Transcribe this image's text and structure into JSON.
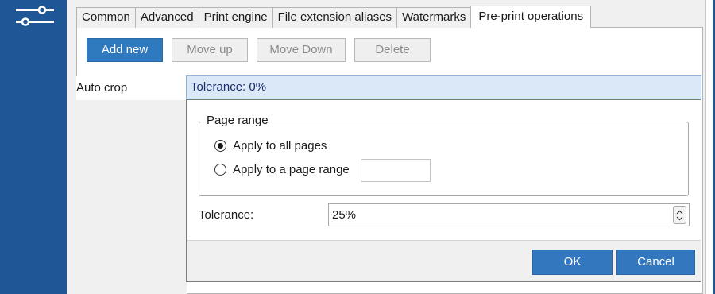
{
  "sidebar": {
    "icon": "settings-sliders-icon",
    "color": "#1f5796"
  },
  "tabs": [
    {
      "label": "Common"
    },
    {
      "label": "Advanced"
    },
    {
      "label": "Print engine"
    },
    {
      "label": "File extension aliases"
    },
    {
      "label": "Watermarks"
    },
    {
      "label": "Pre-print operations",
      "active": true
    }
  ],
  "toolbar": {
    "add_label": "Add new",
    "move_up_label": "Move up",
    "move_down_label": "Move Down",
    "delete_label": "Delete"
  },
  "operations": {
    "items": [
      {
        "label": "Auto crop"
      }
    ],
    "selected_summary": "Tolerance: 0%"
  },
  "dialog": {
    "page_range": {
      "title": "Page range",
      "option_all": "Apply to all pages",
      "option_range": "Apply to a page range",
      "selected": "all",
      "range_value": ""
    },
    "tolerance": {
      "label": "Tolerance:",
      "value": "25%"
    },
    "ok_label": "OK",
    "cancel_label": "Cancel"
  },
  "colors": {
    "accent": "#2f79bf",
    "selection": "#dbe8f7"
  }
}
